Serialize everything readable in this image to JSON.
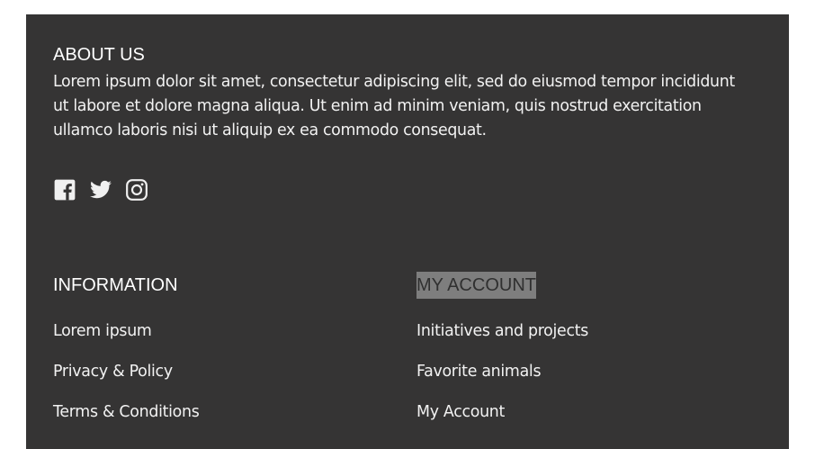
{
  "about": {
    "heading": "ABOUT US",
    "text": "Lorem ipsum dolor sit amet, consectetur adipiscing elit, sed do eiusmod tempor incididunt ut labore et dolore magna aliqua. Ut enim ad minim veniam, quis nostrud exercitation ullamco laboris nisi ut aliquip ex ea commodo consequat."
  },
  "social": {
    "icons": [
      "facebook-icon",
      "twitter-icon",
      "instagram-icon"
    ]
  },
  "information": {
    "heading": "INFORMATION",
    "links": [
      "Lorem ipsum",
      "Privacy & Policy",
      "Terms & Conditions"
    ]
  },
  "account": {
    "heading": "MY ACCOUNT",
    "links": [
      "Initiatives and projects",
      "Favorite animals",
      "My Account"
    ]
  },
  "colors": {
    "footer_background": "#353434",
    "highlight_background": "#7e7e7e",
    "text": "#f2f2f2"
  }
}
